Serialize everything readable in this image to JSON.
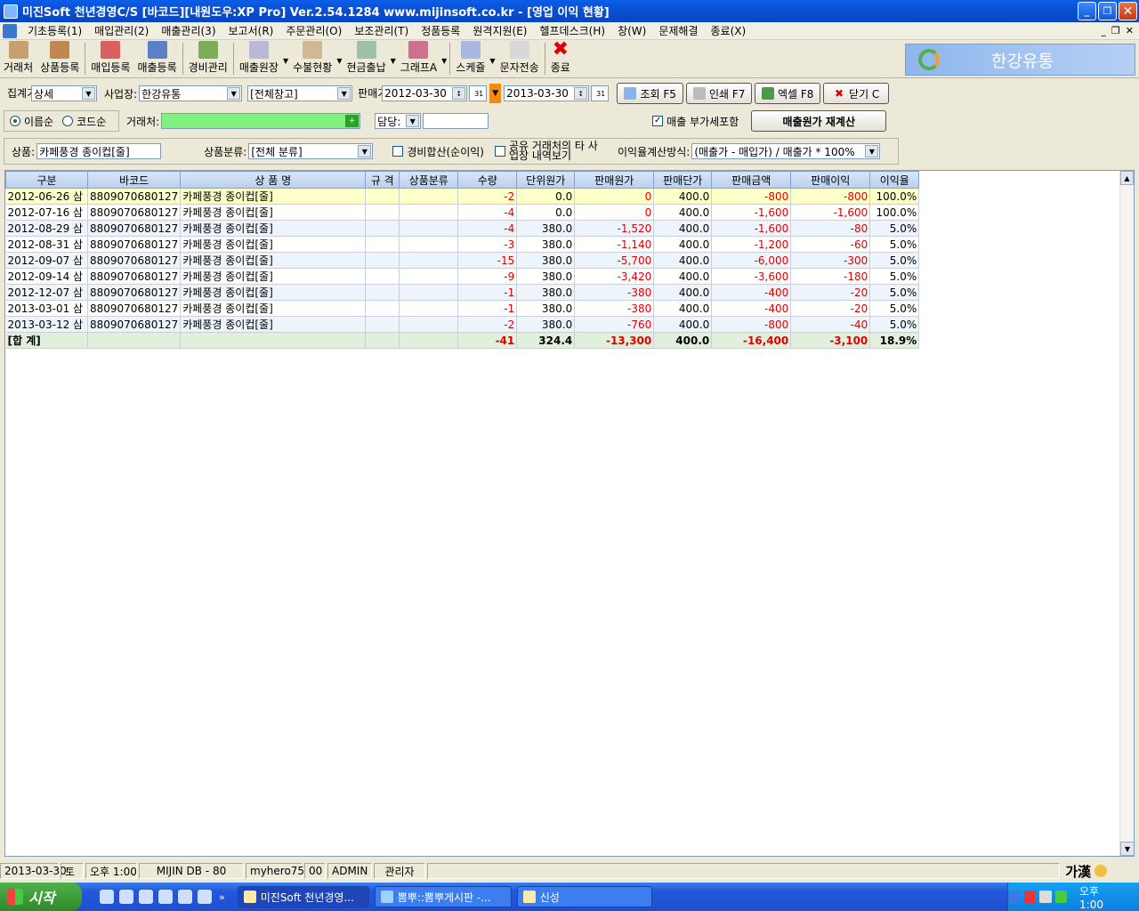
{
  "window": {
    "title": "미진Soft 천년경영C/S [바코드][내원도우:XP Pro] Ver.2.54.1284      www.mijinsoft.co.kr - [영업 이익 현황]"
  },
  "menu": [
    "기초등록(1)",
    "매입관리(2)",
    "매출관리(3)",
    "보고서(R)",
    "주문관리(O)",
    "보조관리(T)",
    "정품등록",
    "원격지원(E)",
    "헬프데스크(H)",
    "창(W)",
    "문제해결",
    "종료(X)"
  ],
  "toolbar": [
    "거래처",
    "상품등록",
    "매입등록",
    "매출등록",
    "경비관리",
    "매출원장",
    "수불현황",
    "현금출납",
    "그래프A",
    "스케쥴",
    "문자전송",
    "종료"
  ],
  "brand": "한강유통",
  "filters": {
    "agg_label": "집계기준",
    "agg_value": "상세",
    "biz_label": "사업장:",
    "biz_value": "한강유통",
    "warehouse_value": "[전체창고]",
    "period_label": "판매기간",
    "date_from": "2012-03-30",
    "date_to": "2013-03-30",
    "date_icon": "31",
    "btn_search": "조회 F5",
    "btn_print": "인쇄 F7",
    "btn_excel": "엑셀 F8",
    "btn_close": "닫기 C",
    "sort_name": "이름순",
    "sort_code": "코드순",
    "client_label": "거래처:",
    "client_plus": "+",
    "manager_label": "담당:",
    "vat_label": "매출 부가세포함",
    "recalc_label": "매출원가 재계산",
    "product_label": "상품:",
    "product_value": "카페풍경 종이컵[줄]",
    "category_label": "상품분류:",
    "category_value": "[전체 분류]",
    "expense_label": "경비합산(순이익)",
    "shared_label": "공유 거래처의 타 사업장 내역보기",
    "method_label": "이익율계산방식:",
    "method_value": "(매출가 - 매입가) / 매출가 * 100%"
  },
  "table": {
    "columns": [
      "구분",
      "바코드",
      "상 품 명",
      "규 격",
      "상품분류",
      "수량",
      "단위원가",
      "판매원가",
      "판매단가",
      "판매금액",
      "판매이익",
      "이익율"
    ],
    "rows": [
      [
        "2012-06-26 삼",
        "8809070680127",
        "카페풍경 종이컵[줄]",
        "",
        "",
        "-2",
        "0.0",
        "0",
        "400.0",
        "-800",
        "-800",
        "100.0%"
      ],
      [
        "2012-07-16 삼",
        "8809070680127",
        "카페풍경 종이컵[줄]",
        "",
        "",
        "-4",
        "0.0",
        "0",
        "400.0",
        "-1,600",
        "-1,600",
        "100.0%"
      ],
      [
        "2012-08-29 삼",
        "8809070680127",
        "카페풍경 종이컵[줄]",
        "",
        "",
        "-4",
        "380.0",
        "-1,520",
        "400.0",
        "-1,600",
        "-80",
        "5.0%"
      ],
      [
        "2012-08-31 삼",
        "8809070680127",
        "카페풍경 종이컵[줄]",
        "",
        "",
        "-3",
        "380.0",
        "-1,140",
        "400.0",
        "-1,200",
        "-60",
        "5.0%"
      ],
      [
        "2012-09-07 삼",
        "8809070680127",
        "카페풍경 종이컵[줄]",
        "",
        "",
        "-15",
        "380.0",
        "-5,700",
        "400.0",
        "-6,000",
        "-300",
        "5.0%"
      ],
      [
        "2012-09-14 삼",
        "8809070680127",
        "카페풍경 종이컵[줄]",
        "",
        "",
        "-9",
        "380.0",
        "-3,420",
        "400.0",
        "-3,600",
        "-180",
        "5.0%"
      ],
      [
        "2012-12-07 삼",
        "8809070680127",
        "카페풍경 종이컵[줄]",
        "",
        "",
        "-1",
        "380.0",
        "-380",
        "400.0",
        "-400",
        "-20",
        "5.0%"
      ],
      [
        "2013-03-01 삼",
        "8809070680127",
        "카페풍경 종이컵[줄]",
        "",
        "",
        "-1",
        "380.0",
        "-380",
        "400.0",
        "-400",
        "-20",
        "5.0%"
      ],
      [
        "2013-03-12 삼",
        "8809070680127",
        "카페풍경 종이컵[줄]",
        "",
        "",
        "-2",
        "380.0",
        "-760",
        "400.0",
        "-800",
        "-40",
        "5.0%"
      ]
    ],
    "total": [
      "[합 계]",
      "",
      "",
      "",
      "",
      "-41",
      "324.4",
      "-13,300",
      "400.0",
      "-16,400",
      "-3,100",
      "18.9%"
    ]
  },
  "status": [
    "2013-03-30",
    "토",
    "오후 1:00",
    "MIJIN DB - 80",
    "myhero75",
    "00",
    "ADMIN",
    "관리자"
  ],
  "ime": "가漢",
  "taskbar": {
    "start": "시작",
    "tasks": [
      "미진Soft 천년경영...",
      "뽐뿌::뽐뿌게시판 -...",
      "신성"
    ],
    "clock": "오후 1:00"
  }
}
